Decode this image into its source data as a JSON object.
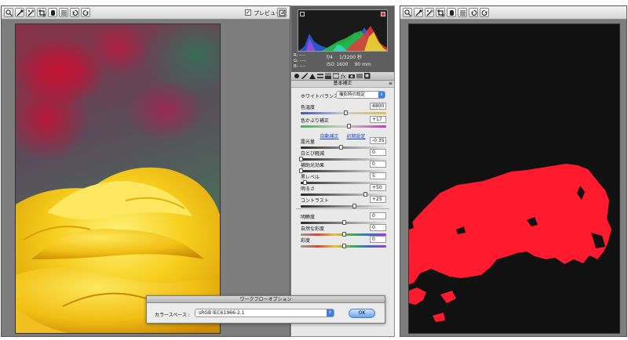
{
  "left_window": {
    "toolbar": {
      "tools": [
        {
          "name": "zoom-tool",
          "icon": "zoom-icon"
        },
        {
          "name": "white-balance-tool",
          "icon": "eyedropper-icon"
        },
        {
          "name": "color-sampler-tool",
          "icon": "sampler-icon"
        },
        {
          "name": "crop-tool",
          "icon": "crop-icon"
        },
        {
          "name": "retouch-tool",
          "icon": "retouch-icon"
        },
        {
          "name": "open-preferences",
          "icon": "list-icon"
        },
        {
          "name": "rotate-ccw",
          "icon": "rotate-ccw-icon"
        },
        {
          "name": "rotate-cw",
          "icon": "rotate-cw-icon"
        }
      ],
      "preview_checked": "✔",
      "preview_label": "プレビュー"
    }
  },
  "panel": {
    "histogram": {
      "rgb_labels": [
        "R:",
        "G:",
        "B:"
      ],
      "rgb_values": [
        "----",
        "----",
        "----"
      ],
      "aperture": "f/4",
      "shutter": "1/3200 秒",
      "iso": "ISO 1600",
      "focal": "90 mm"
    },
    "section_title": "基本補正",
    "section_menu": "≡",
    "white_balance": {
      "label": "ホワイトバランス :",
      "value": "撮影時の設定",
      "arrows": "⇕"
    },
    "temperature": {
      "label": "色温度",
      "value": "4800",
      "level": 0.52
    },
    "tint": {
      "label": "色かぶり補正",
      "value": "+17",
      "level": 0.56
    },
    "auto_links": {
      "auto": "自動補正",
      "default": "初期設定"
    },
    "tone": [
      {
        "label": "露光量",
        "value": "-0.35",
        "level": 0.47
      },
      {
        "label": "白とび軽減",
        "value": "0",
        "level": 0.0
      },
      {
        "label": "補助光効果",
        "value": "0",
        "level": 0.0
      },
      {
        "label": "黒レベル",
        "value": "5",
        "level": 0.05
      },
      {
        "label": "明るさ",
        "value": "+50",
        "level": 0.75
      },
      {
        "label": "コントラスト",
        "value": "+25",
        "level": 0.62
      }
    ],
    "presence": [
      {
        "label": "明瞭度",
        "value": "0",
        "level": 0.5
      },
      {
        "label": "自然な彩度",
        "value": "0",
        "level": 0.5
      },
      {
        "label": "彩度",
        "value": "0",
        "level": 0.5
      }
    ]
  },
  "dialog": {
    "title": "ワークフローオプション",
    "color_space_label": "カラースペース :",
    "color_space_value": "sRGB IEC61966-2.1",
    "arrows": "⇕",
    "ok_label": "OK"
  },
  "colors": {
    "mask_red": "#ff1a2e",
    "mask_bg": "#111111",
    "flower_yellow": "#f5c518",
    "accent_blue": "#3f7fe0"
  }
}
